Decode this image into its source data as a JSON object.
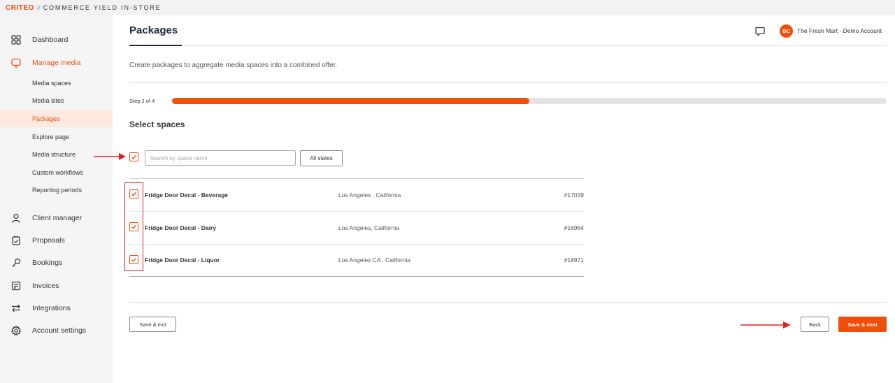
{
  "topbar": {
    "logo": "CRITEO",
    "separator": "//",
    "product": "COMMERCE YIELD IN-STORE"
  },
  "sidebar": {
    "items": [
      {
        "label": "Dashboard",
        "icon": "grid-icon"
      },
      {
        "label": "Manage media",
        "icon": "monitor-icon"
      },
      {
        "label": "Client manager",
        "icon": "person-icon"
      },
      {
        "label": "Proposals",
        "icon": "proposal-icon"
      },
      {
        "label": "Bookings",
        "icon": "key-icon"
      },
      {
        "label": "Invoices",
        "icon": "invoice-icon"
      },
      {
        "label": "Integrations",
        "icon": "arrows-icon"
      },
      {
        "label": "Account settings",
        "icon": "gear-icon"
      }
    ],
    "sub_items": [
      {
        "label": "Media spaces"
      },
      {
        "label": "Media sites"
      },
      {
        "label": "Packages"
      },
      {
        "label": "Explore page"
      },
      {
        "label": "Media structure"
      },
      {
        "label": "Custom workflows"
      },
      {
        "label": "Reporting periods"
      }
    ]
  },
  "header": {
    "title": "Packages",
    "avatar_initials": "BC",
    "account_name": "The Fresh Mart - Demo Account"
  },
  "main": {
    "description": "Create packages to aggregate media spaces into a combined offer.",
    "step_label": "Step 2 of 4",
    "progress_fraction": 0.5,
    "section_title": "Select spaces",
    "search": {
      "placeholder": "Search by space name",
      "value": ""
    },
    "states_label": "All states",
    "rows": [
      {
        "name": "Fridge Door Decal - Beverage",
        "location": "Los Angeles , California",
        "id": "#17039",
        "checked": true
      },
      {
        "name": "Fridge Door Decal - Dairy",
        "location": "Los Angeles, California",
        "id": "#16964",
        "checked": true
      },
      {
        "name": "Fridge Door Decal - Liquor",
        "location": "Los Angeles CA , California",
        "id": "#18971",
        "checked": true
      }
    ]
  },
  "footer": {
    "save_exit_label": "Save & exit",
    "back_label": "Back",
    "save_next_label": "Save & next"
  },
  "colors": {
    "accent": "#f04e0a",
    "annotation": "#e02020",
    "heading": "#1f2a44"
  }
}
